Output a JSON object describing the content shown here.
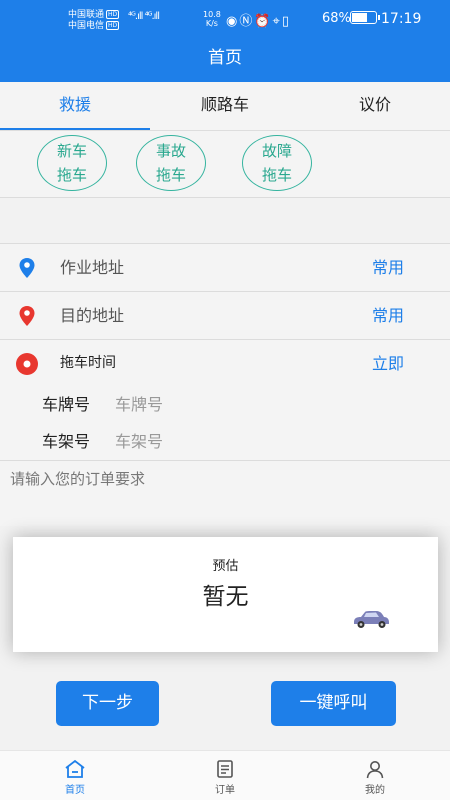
{
  "status_bar": {
    "carrier1": "中国联通",
    "carrier2": "中国电信",
    "hd": "HD",
    "signal": "⁴ᴳ.ıll ⁴ᴳ.ıll",
    "speed_value": "10.8",
    "speed_unit": "K/s",
    "battery": "68%",
    "battery_level": 0.68,
    "time": "17:19"
  },
  "header": {
    "title": "首页"
  },
  "tabs": [
    {
      "label": "救援",
      "active": true
    },
    {
      "label": "顺路车",
      "active": false
    },
    {
      "label": "议价",
      "active": false
    }
  ],
  "service_types": [
    {
      "line1": "新车",
      "line2": "拖车"
    },
    {
      "line1": "事故",
      "line2": "拖车"
    },
    {
      "line1": "故障",
      "line2": "拖车"
    }
  ],
  "form": {
    "work_address": {
      "label": "作业地址",
      "action": "常用"
    },
    "destination": {
      "label": "目的地址",
      "action": "常用"
    },
    "tow_time": {
      "label": "拖车时间",
      "action": "立即"
    },
    "plate": {
      "label": "车牌号",
      "placeholder": "车牌号"
    },
    "frame": {
      "label": "车架号",
      "placeholder": "车架号"
    },
    "remark_placeholder": "请输入您的订单要求"
  },
  "estimate": {
    "label": "预估",
    "value": "暂无"
  },
  "buttons": {
    "next": "下一步",
    "call": "一键呼叫"
  },
  "bottom_nav": [
    {
      "label": "首页",
      "icon": "home-icon",
      "active": true
    },
    {
      "label": "订单",
      "icon": "order-list-icon",
      "active": false
    },
    {
      "label": "我的",
      "icon": "user-icon",
      "active": false
    }
  ],
  "colors": {
    "primary": "#1e7fe9",
    "accent_teal": "#35b49f",
    "pin_blue": "#1e7fe9",
    "pin_red": "#e8372f"
  }
}
